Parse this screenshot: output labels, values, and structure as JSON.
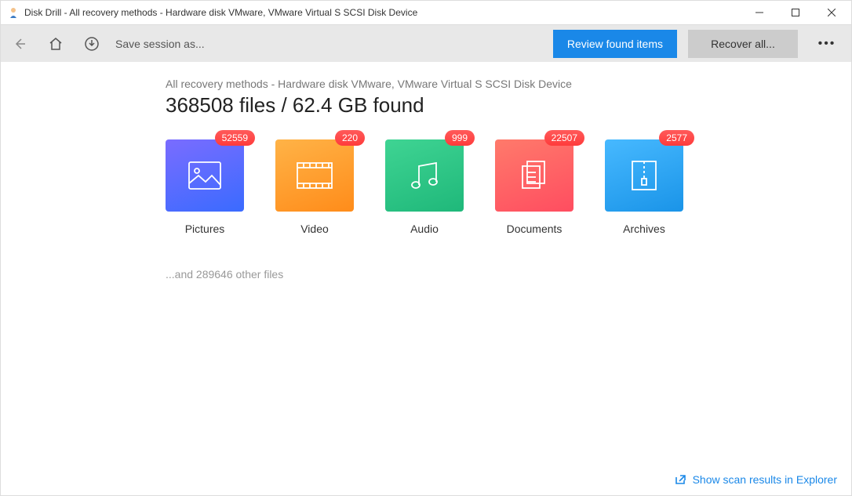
{
  "window": {
    "title": "Disk Drill - All recovery methods - Hardware disk VMware, VMware Virtual S SCSI Disk Device"
  },
  "toolbar": {
    "save_session_label": "Save session as...",
    "review_label": "Review found items",
    "recover_label": "Recover all..."
  },
  "main": {
    "subtitle": "All recovery methods - Hardware disk VMware, VMware Virtual S SCSI Disk Device",
    "headline": "368508 files / 62.4 GB found",
    "other_files": "...and 289646 other files"
  },
  "categories": [
    {
      "id": "pictures",
      "label": "Pictures",
      "count": "52559"
    },
    {
      "id": "video",
      "label": "Video",
      "count": "220"
    },
    {
      "id": "audio",
      "label": "Audio",
      "count": "999"
    },
    {
      "id": "documents",
      "label": "Documents",
      "count": "22507"
    },
    {
      "id": "archives",
      "label": "Archives",
      "count": "2577"
    }
  ],
  "footer": {
    "explorer_label": "Show scan results in Explorer"
  }
}
